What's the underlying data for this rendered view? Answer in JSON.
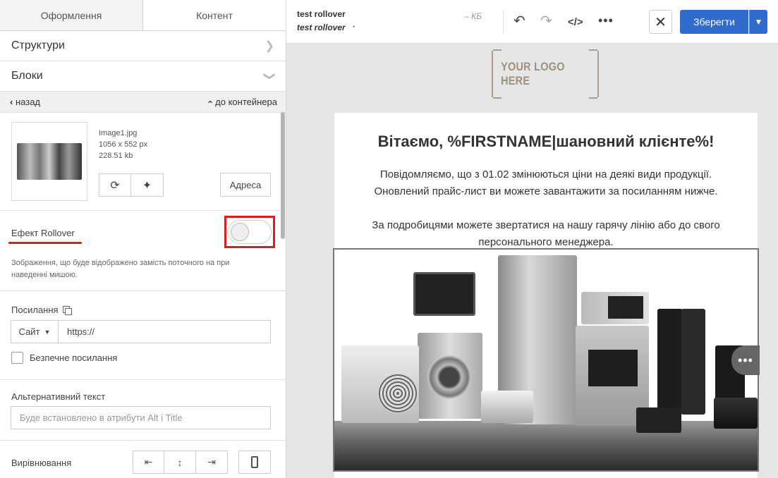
{
  "left_panel": {
    "tabs": [
      {
        "label": "Оформлення",
        "active": false
      },
      {
        "label": "Контент",
        "active": true
      }
    ],
    "accordion": [
      {
        "label": "Структури"
      },
      {
        "label": "Блоки"
      }
    ],
    "nav": {
      "back": "назад",
      "to_container": "до контейнера"
    },
    "image": {
      "filename": "Image1.jpg",
      "dimensions": "1056 x 552 px",
      "size": "228.51 kb",
      "address_button": "Адреса"
    },
    "rollover": {
      "label": "Ефект Rollover",
      "enabled": false,
      "description": "Зображення, що буде відображено замість поточного на при наведенні мишою."
    },
    "link": {
      "label": "Посилання",
      "type": "Сайт",
      "url": "https://",
      "safe_label": "Безпечне посилання"
    },
    "alt": {
      "label": "Альтернативний текст",
      "placeholder": "Буде встановлено в атрибути Alt і Title"
    },
    "alignment": {
      "label": "Вирівнювання"
    }
  },
  "topbar": {
    "title": "test rollover",
    "subtitle": "test rollover",
    "subtitle_dot": "•",
    "size": "– КБ",
    "close_glyph": "✕",
    "save_label": "Зберегти",
    "icons": [
      "undo-icon",
      "redo-icon",
      "code-icon",
      "more-icon"
    ]
  },
  "canvas": {
    "logo_text": "YOUR LOGO HERE",
    "greeting": "Вітаємо, %FIRSTNAME|шановний клієнте%!",
    "paragraph_1_line_1": "Повідомляємо, що з 01.02 змінюються ціни на деякі види продукції.",
    "paragraph_1_line_2": "Оновлений прайс-лист ви можете завантажити за посиланням нижче.",
    "paragraph_2_line_1": "За подробицями можете звертатися на нашу гарячу лінію або до свого",
    "paragraph_2_line_2": "персонального менеджера."
  },
  "colors": {
    "accent": "#2f6cce",
    "highlight": "#e01c1c",
    "logo": "#9b927e"
  }
}
